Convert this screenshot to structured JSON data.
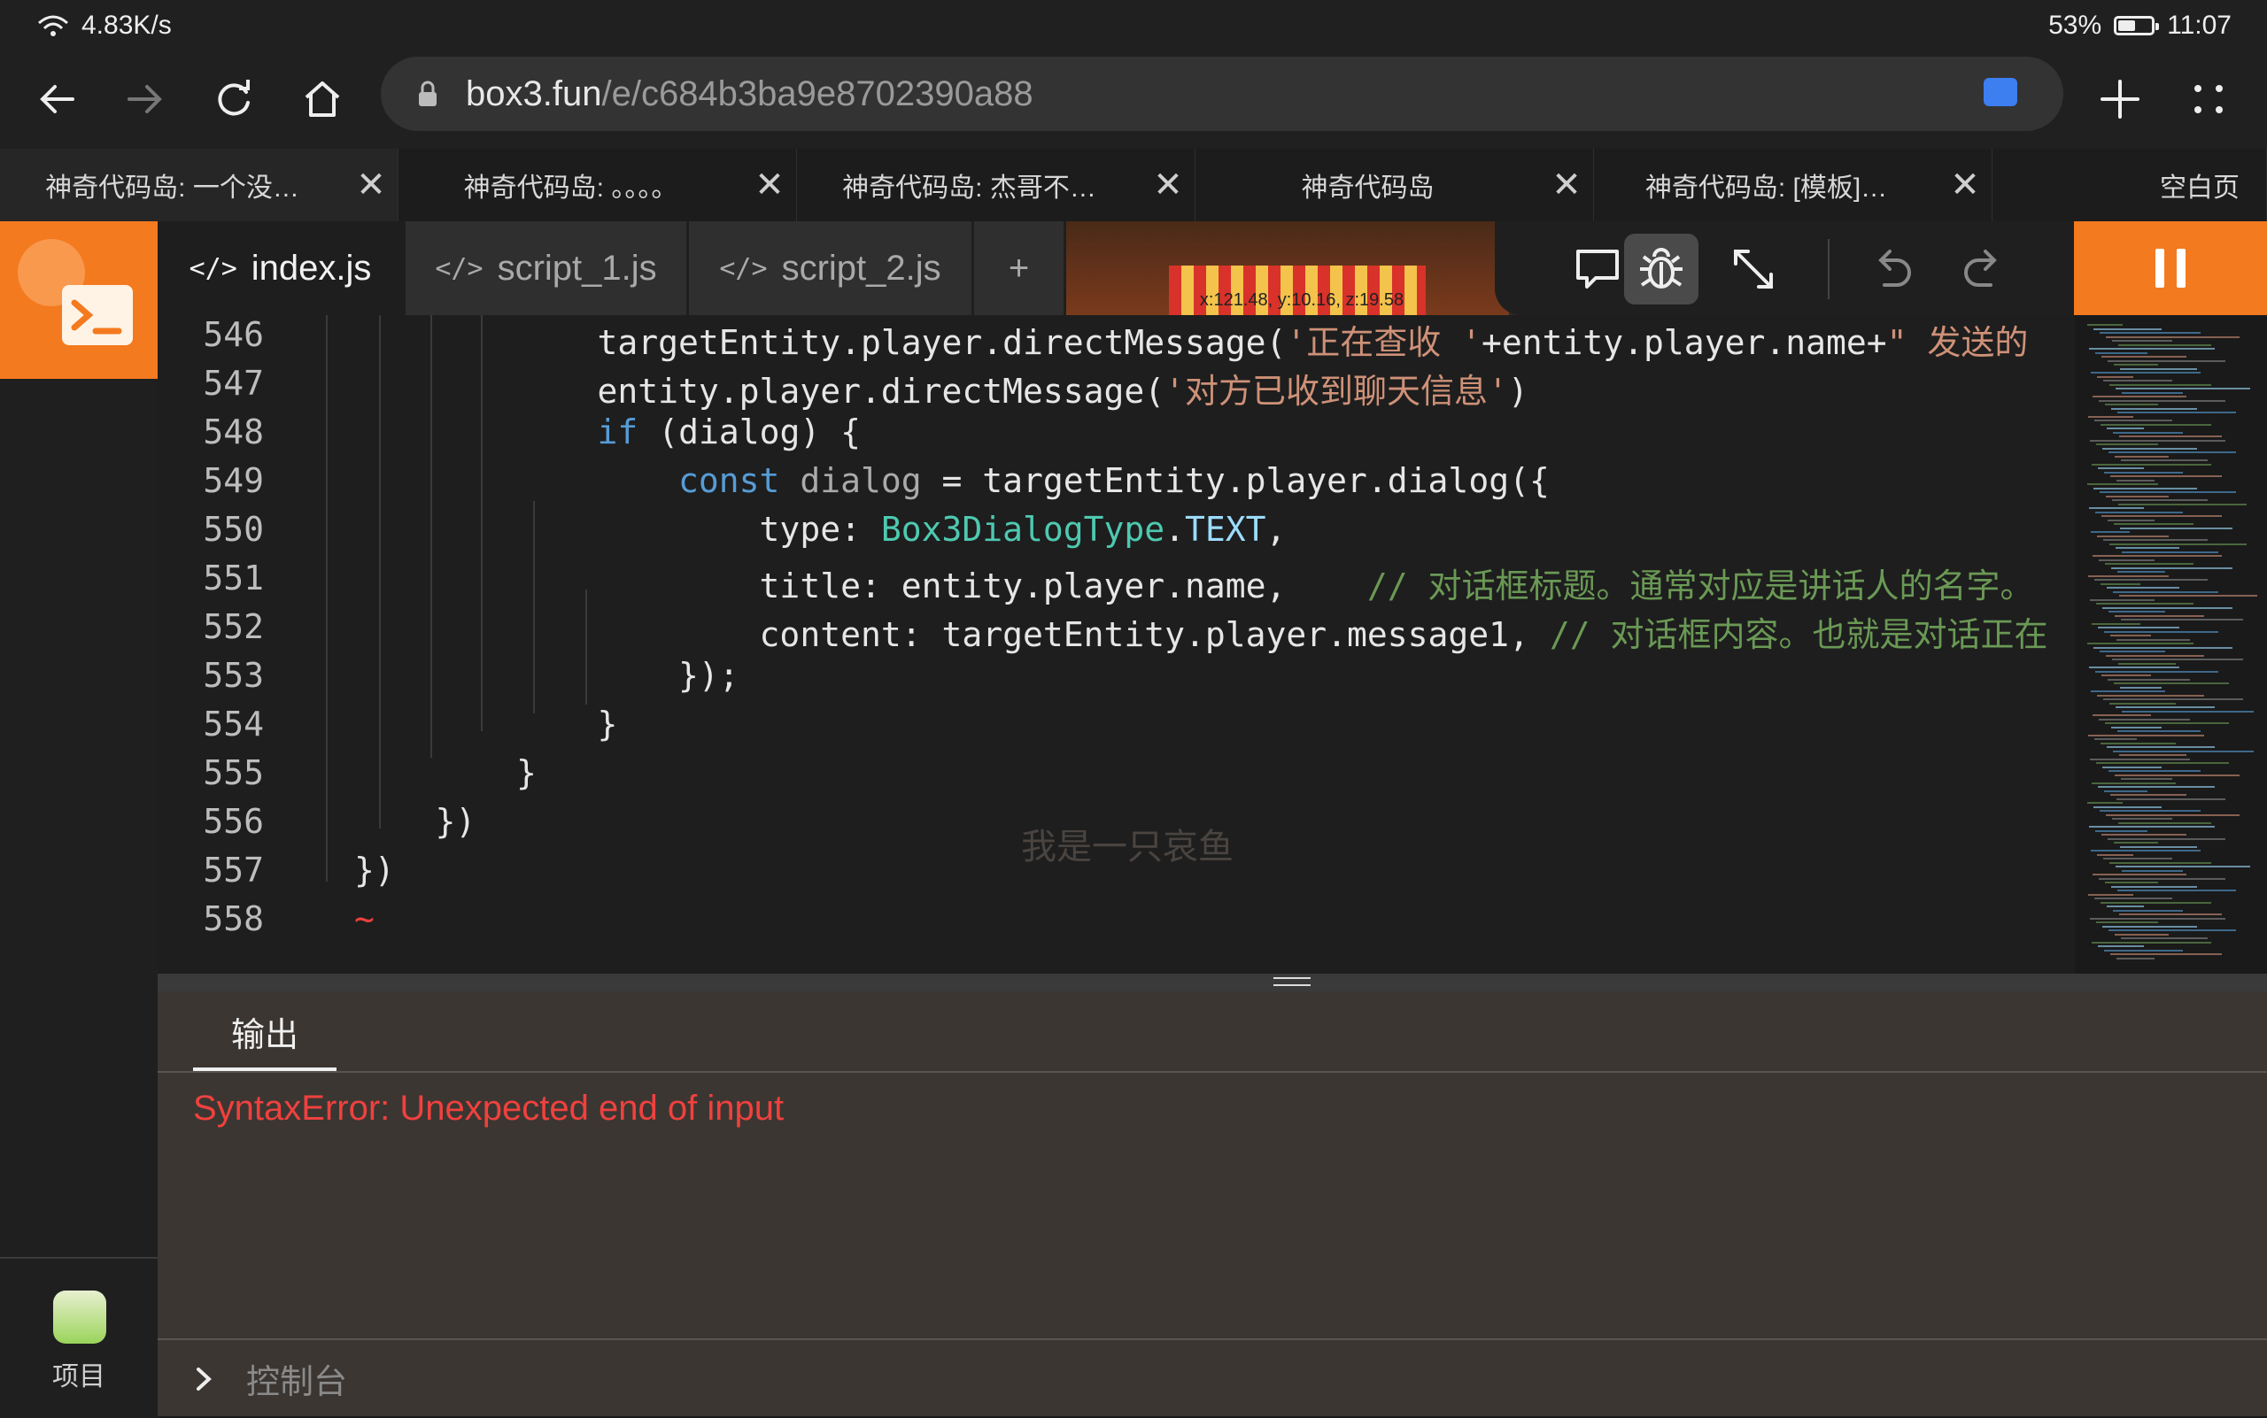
{
  "status": {
    "network_speed": "4.83K/s",
    "battery": "53%",
    "battery_level": 0.53,
    "time": "11:07"
  },
  "browser": {
    "url_host": "box3.fun",
    "url_path": "/e/c684b3ba9e8702390a88",
    "tabs": [
      {
        "title": "神奇代码岛: 一个没…",
        "active": true
      },
      {
        "title": "神奇代码岛: 。。。。"
      },
      {
        "title": "神奇代码岛: 杰哥不…"
      },
      {
        "title": "神奇代码岛"
      },
      {
        "title": "神奇代码岛: [模板]…"
      },
      {
        "title": "空白页"
      }
    ],
    "close_glyph": "✕"
  },
  "editor": {
    "files": [
      {
        "name": "index.js",
        "active": true
      },
      {
        "name": "script_1.js"
      },
      {
        "name": "script_2.js"
      }
    ],
    "file_icon": "</>",
    "add_label": "+",
    "coords": "x:121.48, y:10.16, z:19.58",
    "watermark": "我是一只哀鱼",
    "line_numbers": [
      "546",
      "547",
      "548",
      "549",
      "550",
      "551",
      "552",
      "553",
      "554",
      "555",
      "556",
      "557",
      "558"
    ]
  },
  "output": {
    "tab_label": "输出",
    "error": "SyntaxError: Unexpected end of input",
    "console_label": "控制台"
  },
  "sidebar": {
    "project_label": "项目"
  },
  "colors": {
    "accent": "#f47a1f",
    "error": "#f0413e",
    "keyword": "#569cd6",
    "string": "#ce9178",
    "comment": "#6a9955",
    "type": "#4ec9b0"
  }
}
